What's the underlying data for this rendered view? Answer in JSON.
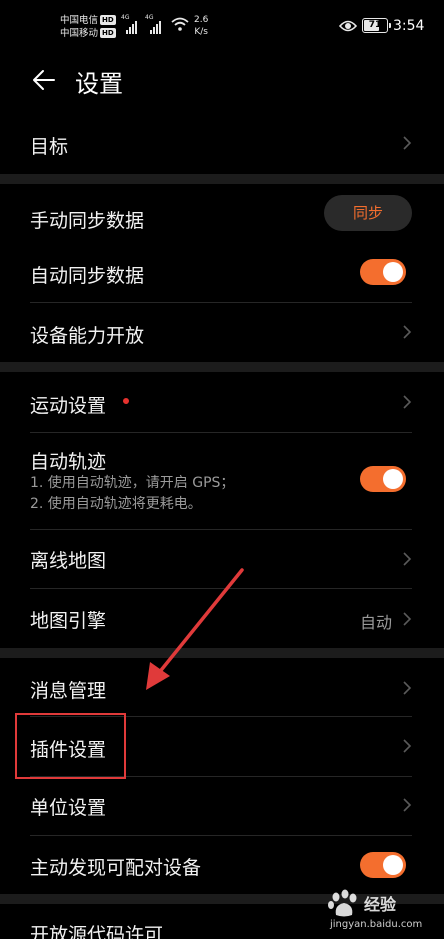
{
  "status_bar": {
    "carrier1": "中国电信",
    "carrier2": "中国移动",
    "hd": "HD",
    "net1": "4G",
    "net2": "4G",
    "speed_value": "2.6",
    "speed_unit": "K/s",
    "battery": "71",
    "battery_level": 0.71,
    "time": "3:54"
  },
  "header": {
    "title": "设置"
  },
  "items": {
    "goal": "目标",
    "manual_sync": "手动同步数据",
    "sync_button": "同步",
    "auto_sync": "自动同步数据",
    "device_open": "设备能力开放",
    "sport_settings": "运动设置",
    "auto_track": "自动轨迹",
    "auto_track_sub1": "1. 使用自动轨迹，请开启 GPS；",
    "auto_track_sub2": "2. 使用自动轨迹将更耗电。",
    "offline_map": "离线地图",
    "map_engine": "地图引擎",
    "map_engine_value": "自动",
    "msg_manage": "消息管理",
    "plugin_settings": "插件设置",
    "unit_settings": "单位设置",
    "discover_devices": "主动发现可配对设备",
    "open_source": "开放源代码许可"
  },
  "toggles": {
    "auto_sync": true,
    "auto_track": true,
    "discover_devices": true
  },
  "colors": {
    "accent": "#f46e2e",
    "annotation": "#e03a3a",
    "background": "#000000"
  },
  "watermark": {
    "text": "经验",
    "url": "jingyan.baidu.com"
  }
}
